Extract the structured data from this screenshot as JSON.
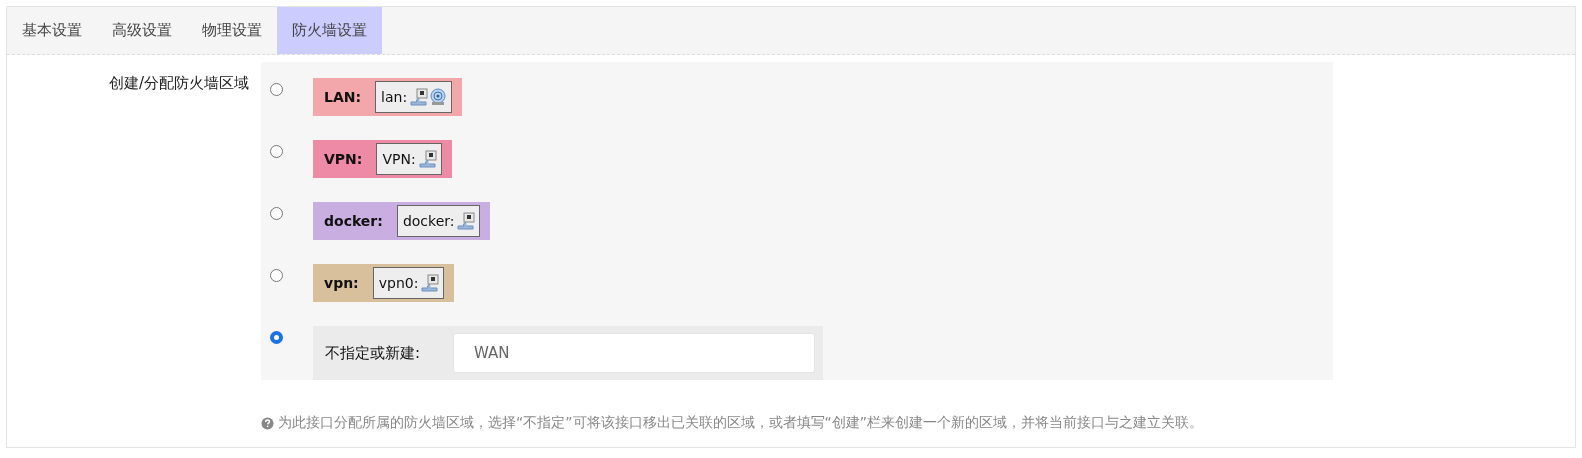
{
  "tabs": [
    {
      "label": "基本设置",
      "selected": false
    },
    {
      "label": "高级设置",
      "selected": false
    },
    {
      "label": "物理设置",
      "selected": false
    },
    {
      "label": "防火墙设置",
      "selected": true
    }
  ],
  "field": {
    "label": "创建/分配防火墙区域",
    "zones": [
      {
        "name": "LAN:",
        "color": "#f4a7aa",
        "selected": false,
        "interface": "lan:",
        "devices": [
          {
            "kind": "wired"
          },
          {
            "kind": "wireless"
          }
        ]
      },
      {
        "name": "VPN:",
        "color": "#ee8aa5",
        "selected": false,
        "interface": "VPN:",
        "devices": [
          {
            "kind": "wired"
          }
        ]
      },
      {
        "name": "docker:",
        "color": "#c9aee1",
        "selected": false,
        "interface": "docker:",
        "devices": [
          {
            "kind": "wired"
          }
        ]
      },
      {
        "name": "vpn:",
        "color": "#d8c09d",
        "selected": false,
        "interface": "vpn0:",
        "devices": [
          {
            "kind": "wired"
          }
        ]
      }
    ],
    "custom": {
      "selected": true,
      "label": "不指定或新建:",
      "value": "WAN"
    },
    "help": "为此接口分配所属的防火墙区域，选择“不指定”可将该接口移出已关联的区域，或者填写“创建”栏来创建一个新的区域，并将当前接口与之建立关联。"
  }
}
